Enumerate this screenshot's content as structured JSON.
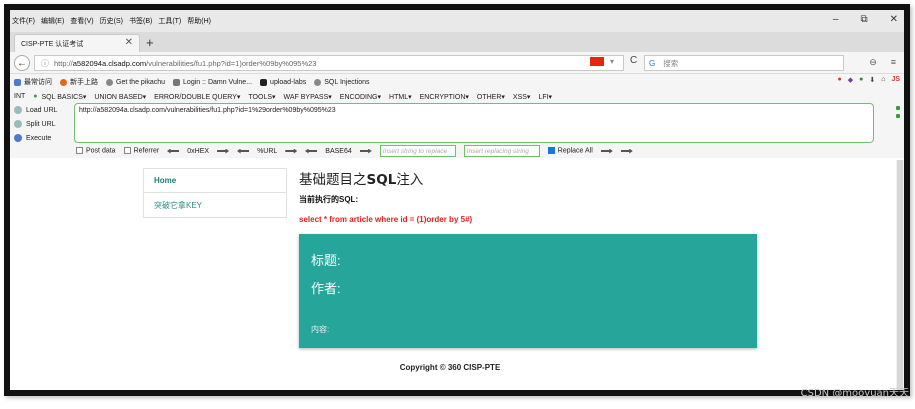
{
  "menubar": {
    "items": [
      "文件(F)",
      "编辑(E)",
      "查看(V)",
      "历史(S)",
      "书签(B)",
      "工具(T)",
      "帮助(H)"
    ]
  },
  "window_controls": {
    "minimize": "–",
    "restore": "⧉",
    "close": "✕"
  },
  "tab": {
    "title": "CISP-PTE 认证考试",
    "close": "✕",
    "new_tab": "+"
  },
  "nav": {
    "back": "←",
    "info": "ⓘ",
    "url_prefix": "http://",
    "url_host": "a582094a.clsadp.com",
    "url_path": "/vulnerabilities/fu1.php?id=1)order%09by%095%23",
    "dropdown": "▾",
    "reload": "C",
    "search_icon": "G",
    "search_placeholder": "搜索",
    "right_icons": [
      "⊖",
      "≡"
    ]
  },
  "bookmarks": {
    "items": [
      "最常访问",
      "新手上路",
      "Get the pikachu",
      "Login :: Damn Vulne...",
      "upload-labs",
      "SQL Injections"
    ],
    "right": "JS"
  },
  "hackbar": {
    "type": "INT",
    "menus": [
      "SQL BASICS▾",
      "UNION BASED▾",
      "ERROR/DOUBLE QUERY▾",
      "TOOLS▾",
      "WAF BYPASS▾",
      "ENCODING▾",
      "HTML▾",
      "ENCRYPTION▾",
      "OTHER▾",
      "XSS▾",
      "LFI▾"
    ],
    "actions": [
      "Load URL",
      "Split URL",
      "Execute"
    ],
    "url_value": "http://a582094a.clsadp.com/vulnerabilities/fu1.php?id=1%29order%09by%095%23",
    "options": {
      "post_data": "Post data",
      "referrer": "Referrer",
      "hex": "0xHEX",
      "url": "%URL",
      "base64": "BASE64",
      "replace_placeholder": "Insert string to replace",
      "replacing_placeholder": "Insert replacing string",
      "replace_all": "Replace All"
    }
  },
  "page": {
    "sidebar": [
      {
        "label": "Home",
        "active": true
      },
      {
        "label": "突破它拿KEY",
        "active": false
      }
    ],
    "title_prefix": "基础题目之",
    "title_bold": "SQL",
    "title_suffix": "注入",
    "sql_label": "当前执行的SQL:",
    "sql_query": "select * from article where id = (1)order by 5#)",
    "card": {
      "title_label": "标题:",
      "author_label": "作者:",
      "content_label": "内容:"
    },
    "footer": "Copyright © 360 CISP-PTE"
  },
  "watermark": "CSDN @mooyuan天天",
  "colors": {
    "accent": "#26a69a",
    "sql_red": "#e02020",
    "link_teal": "#2a8f83"
  }
}
